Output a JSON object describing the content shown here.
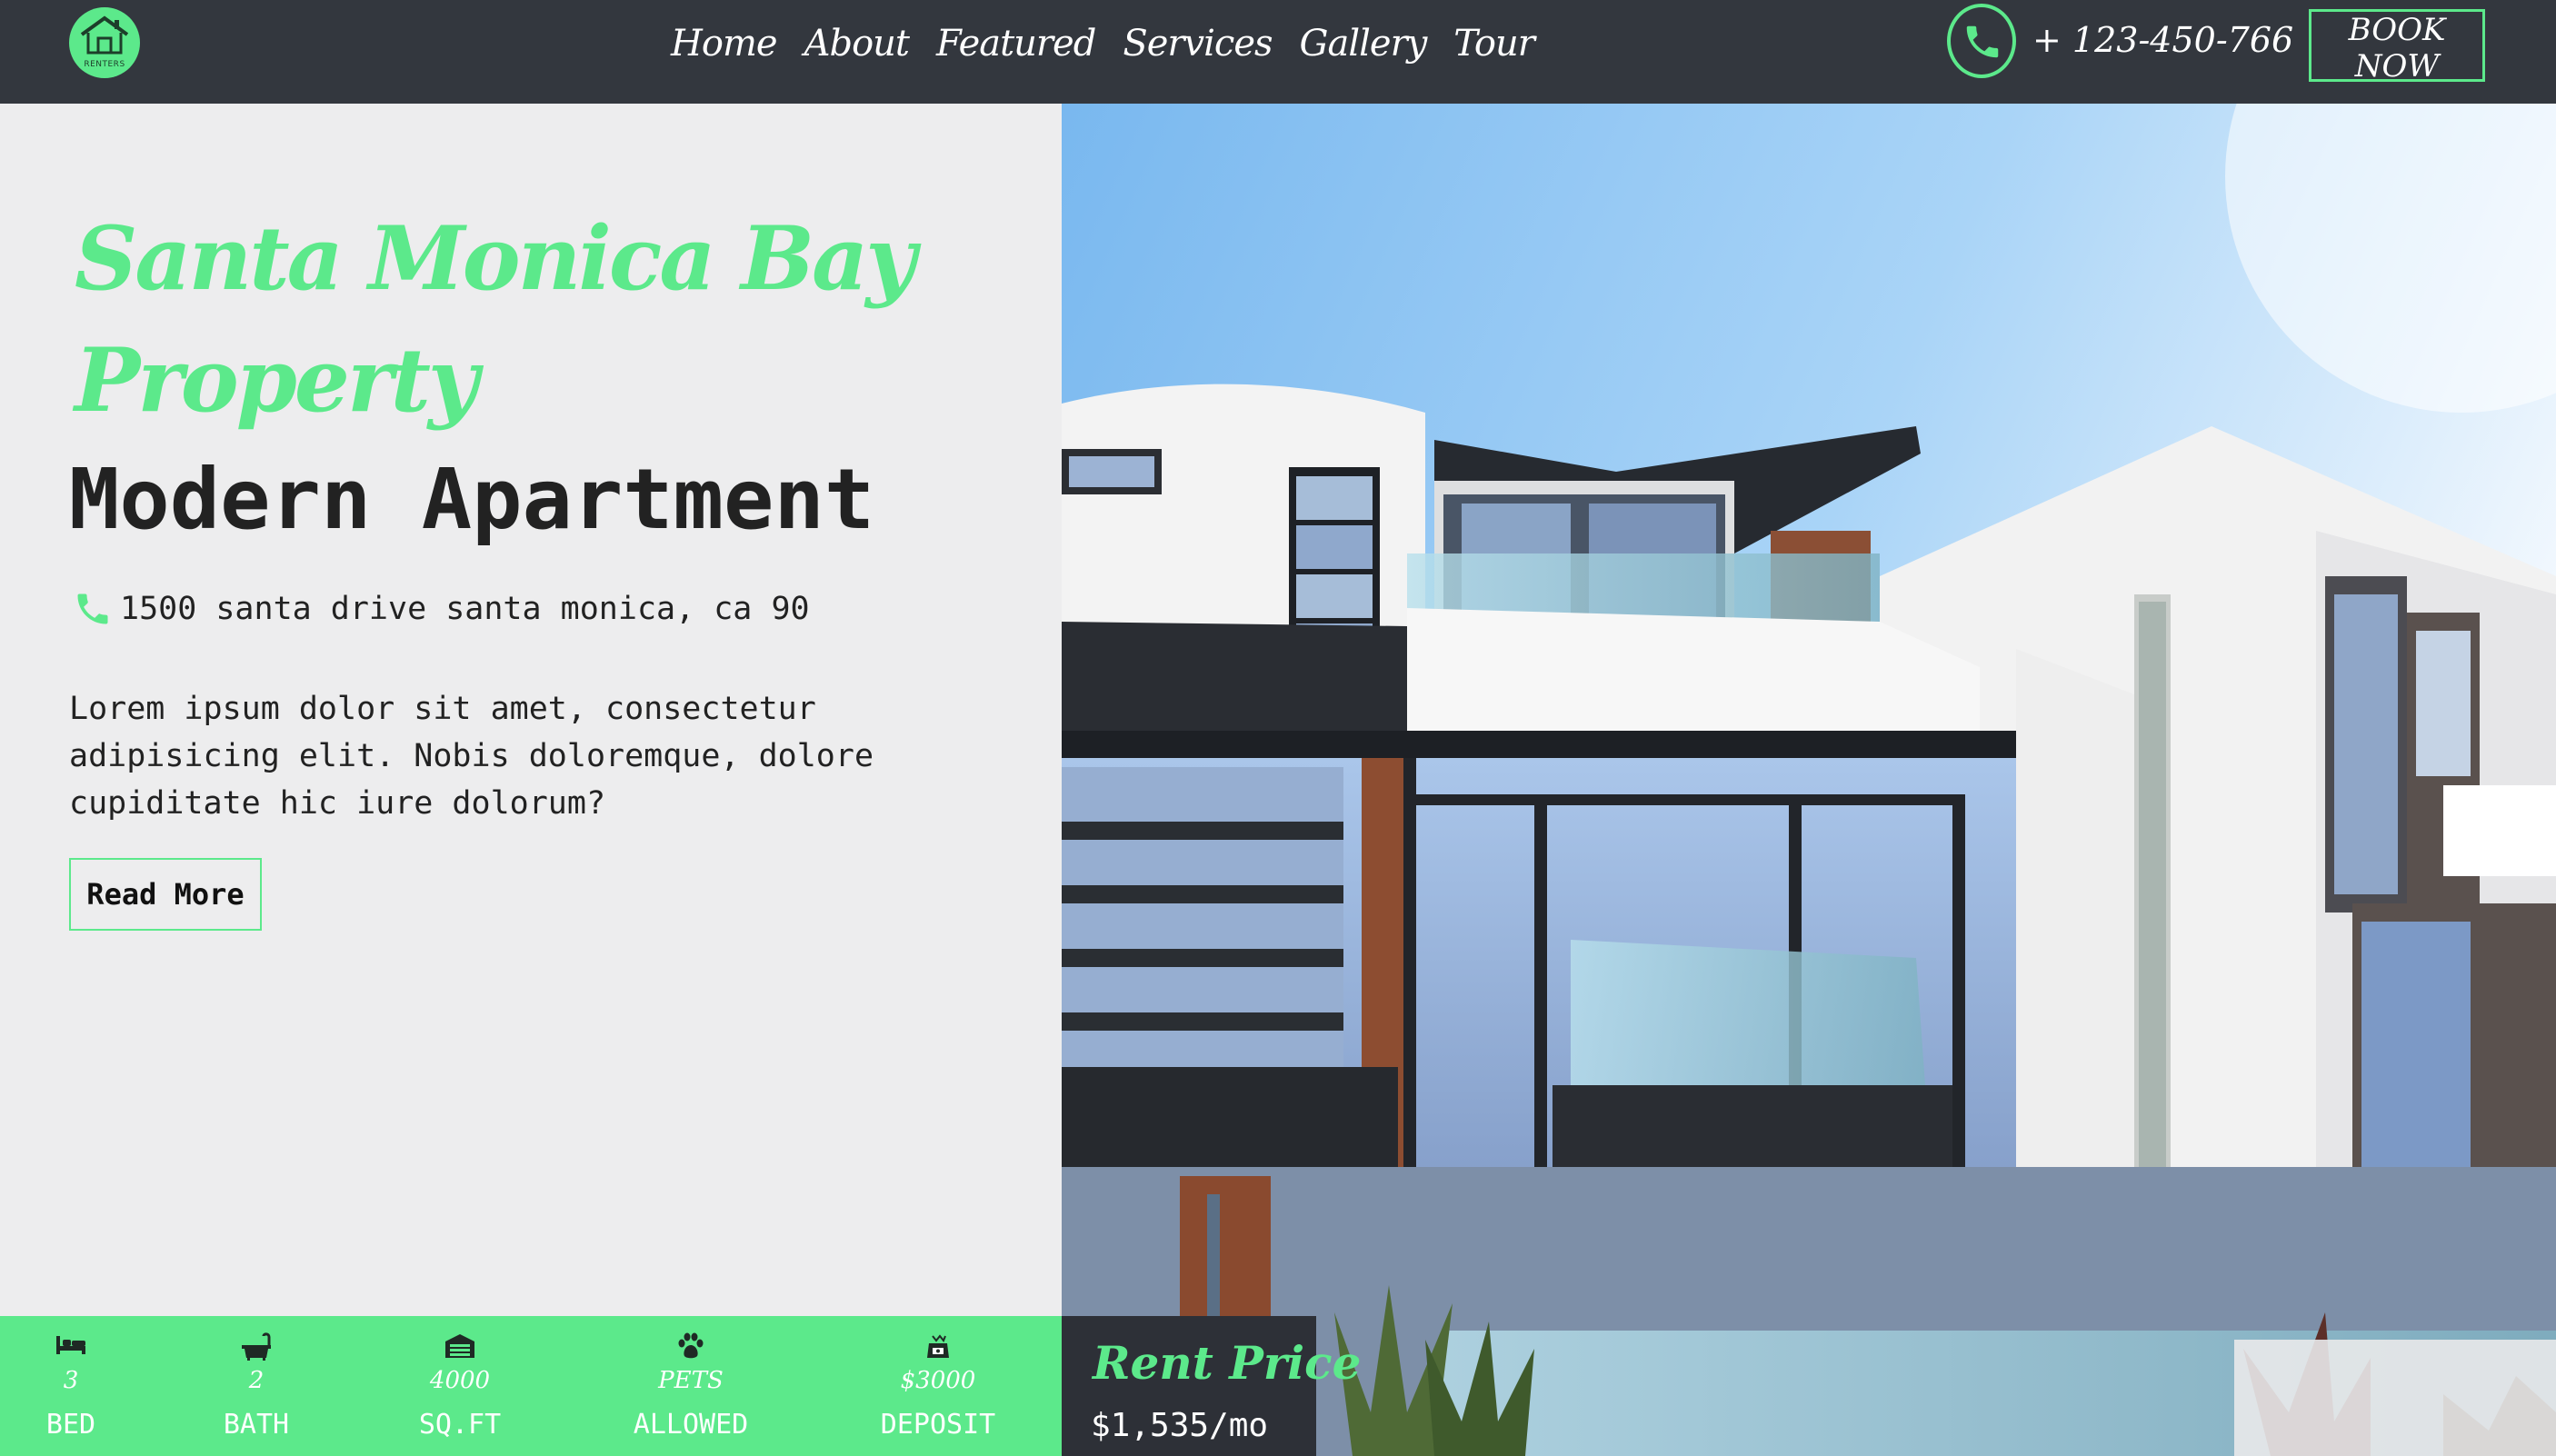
{
  "brand": {
    "logo_text": "RENTERS"
  },
  "nav": {
    "links": [
      "Home",
      "About",
      "Featured",
      "Services",
      "Gallery",
      "Tour"
    ],
    "phone": "+ 123-450-766",
    "book_now": "BOOK NOW"
  },
  "hero": {
    "script_title": "Santa Monica Bay Property",
    "title": "Modern Apartment",
    "address": "1500 santa drive santa monica, ca 90",
    "description": "Lorem ipsum dolor sit amet, consectetur adipisicing elit. Nobis doloremque, dolore cupiditate hic iure dolorum?",
    "read_more": "Read More"
  },
  "features": [
    {
      "icon": "bed-icon",
      "value": "3",
      "label": "BED"
    },
    {
      "icon": "bathtub-icon",
      "value": "2",
      "label": "BATH"
    },
    {
      "icon": "garage-icon",
      "value": "4000",
      "label": "SQ.FT"
    },
    {
      "icon": "paw-icon",
      "value": "PETS",
      "label": "ALLOWED"
    },
    {
      "icon": "money-bag-icon",
      "value": "$3000",
      "label": "DEPOSIT"
    }
  ],
  "rent": {
    "label": "Rent Price",
    "value": "$1,535/mo"
  },
  "colors": {
    "accent": "#5ce98b",
    "nav_bg": "#33373e",
    "panel_bg": "#ededee",
    "text": "#222222"
  }
}
